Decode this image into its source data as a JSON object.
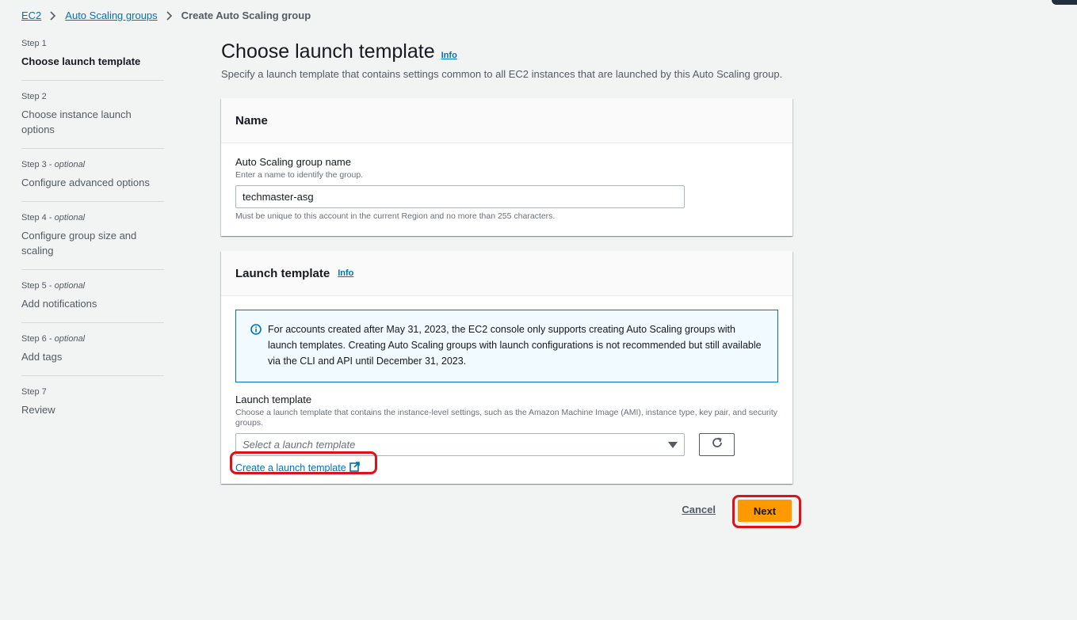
{
  "breadcrumb": {
    "items": [
      "EC2",
      "Auto Scaling groups"
    ],
    "current": "Create Auto Scaling group"
  },
  "steps": [
    {
      "num": "Step 1",
      "optional": "",
      "title": "Choose launch template"
    },
    {
      "num": "Step 2",
      "optional": "",
      "title": "Choose instance launch options"
    },
    {
      "num": "Step 3",
      "optional": "optional",
      "title": "Configure advanced options"
    },
    {
      "num": "Step 4",
      "optional": "optional",
      "title": "Configure group size and scaling"
    },
    {
      "num": "Step 5",
      "optional": "optional",
      "title": "Add notifications"
    },
    {
      "num": "Step 6",
      "optional": "optional",
      "title": "Add tags"
    },
    {
      "num": "Step 7",
      "optional": "",
      "title": "Review"
    }
  ],
  "page": {
    "title": "Choose launch template",
    "info": "Info",
    "description": "Specify a launch template that contains settings common to all EC2 instances that are launched by this Auto Scaling group."
  },
  "name_panel": {
    "header": "Name",
    "label": "Auto Scaling group name",
    "description": "Enter a name to identify the group.",
    "value": "techmaster-asg",
    "constraint": "Must be unique to this account in the current Region and no more than 255 characters."
  },
  "lt_panel": {
    "header": "Launch template",
    "info": "Info",
    "alert": "For accounts created after May 31, 2023, the EC2 console only supports creating Auto Scaling groups with launch templates. Creating Auto Scaling groups with launch configurations is not recommended but still available via the CLI and API until December 31, 2023.",
    "label": "Launch template",
    "description": "Choose a launch template that contains the instance-level settings, such as the Amazon Machine Image (AMI), instance type, key pair, and security groups.",
    "placeholder": "Select a launch template",
    "create_link": "Create a launch template"
  },
  "actions": {
    "cancel": "Cancel",
    "next": "Next"
  },
  "colors": {
    "link": "#0073bb",
    "primary": "#ff9900",
    "highlight": "#e0101a"
  }
}
